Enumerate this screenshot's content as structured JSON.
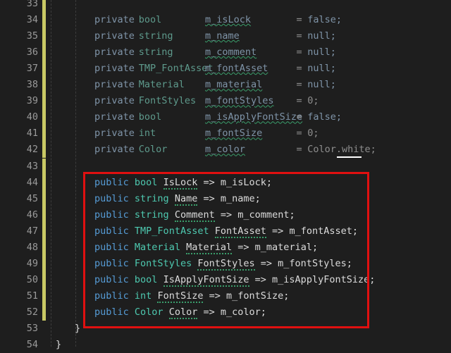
{
  "editor": {
    "lines": [
      {
        "n": "33",
        "margin": "#c8c864",
        "kind": "blank"
      },
      {
        "n": "34",
        "margin": "#c8c864",
        "kind": "field",
        "mod": "private",
        "type": "bool",
        "name": "m_isLock",
        "val": "false;",
        "valkw": true
      },
      {
        "n": "35",
        "margin": "#c8c864",
        "kind": "field",
        "mod": "private",
        "type": "string",
        "name": "m_name",
        "val": "null;",
        "valkw": true
      },
      {
        "n": "36",
        "margin": "#c8c864",
        "kind": "field",
        "mod": "private",
        "type": "string",
        "name": "m_comment",
        "val": "null;",
        "valkw": true
      },
      {
        "n": "37",
        "margin": "#c8c864",
        "kind": "field",
        "mod": "private",
        "type": "TMP_FontAsset",
        "name": "m_fontAsset",
        "val": "null;",
        "valkw": true
      },
      {
        "n": "38",
        "margin": "#c8c864",
        "kind": "field",
        "mod": "private",
        "type": "Material",
        "name": "m_material",
        "val": "null;",
        "valkw": true
      },
      {
        "n": "39",
        "margin": "#c8c864",
        "kind": "field",
        "mod": "private",
        "type": "FontStyles",
        "name": "m_fontStyles",
        "val": "0;",
        "valkw": false
      },
      {
        "n": "40",
        "margin": "#c8c864",
        "kind": "field",
        "mod": "private",
        "type": "bool",
        "name": "m_isApplyFontSize",
        "val": "false;",
        "valkw": true
      },
      {
        "n": "41",
        "margin": "#c8c864",
        "kind": "field",
        "mod": "private",
        "type": "int",
        "name": "m_fontSize",
        "val": "0;",
        "valkw": false
      },
      {
        "n": "42",
        "margin": "#c8c864",
        "kind": "field",
        "mod": "private",
        "type": "Color",
        "name": "m_color",
        "val": "Color.white;",
        "valkw": false
      },
      {
        "n": "43",
        "margin": "#c8c864",
        "kind": "blank"
      },
      {
        "n": "44",
        "margin": "#c8c864",
        "kind": "prop",
        "mod": "public",
        "type": "bool",
        "name": "IsLock",
        "arrow": "=>",
        "target": "m_isLock;"
      },
      {
        "n": "45",
        "margin": "#c8c864",
        "kind": "prop",
        "mod": "public",
        "type": "string",
        "name": "Name",
        "arrow": "=>",
        "target": "m_name;"
      },
      {
        "n": "46",
        "margin": "#c8c864",
        "kind": "prop",
        "mod": "public",
        "type": "string",
        "name": "Comment",
        "arrow": "=>",
        "target": "m_comment;"
      },
      {
        "n": "47",
        "margin": "#c8c864",
        "kind": "prop",
        "mod": "public",
        "type": "TMP_FontAsset",
        "name": "FontAsset",
        "arrow": "=>",
        "target": "m_fontAsset;"
      },
      {
        "n": "48",
        "margin": "#c8c864",
        "kind": "prop",
        "mod": "public",
        "type": "Material",
        "name": "Material",
        "arrow": "=>",
        "target": "m_material;"
      },
      {
        "n": "49",
        "margin": "#c8c864",
        "kind": "prop",
        "mod": "public",
        "type": "FontStyles",
        "name": "FontStyles",
        "arrow": "=>",
        "target": "m_fontStyles;"
      },
      {
        "n": "50",
        "margin": "#c8c864",
        "kind": "prop",
        "mod": "public",
        "type": "bool",
        "name": "IsApplyFontSize",
        "arrow": "=>",
        "target": "m_isApplyFontSize;"
      },
      {
        "n": "51",
        "margin": "#c8c864",
        "kind": "prop",
        "mod": "public",
        "type": "int",
        "name": "FontSize",
        "arrow": "=>",
        "target": "m_fontSize;"
      },
      {
        "n": "52",
        "margin": "#c8c864",
        "kind": "prop",
        "mod": "public",
        "type": "Color",
        "name": "Color",
        "arrow": "=>",
        "target": "m_color;"
      },
      {
        "n": "53",
        "margin": "",
        "kind": "brace",
        "text": "}"
      },
      {
        "n": "54",
        "margin": "",
        "kind": "brace2",
        "text": "}"
      }
    ],
    "colors": {
      "background": "#1e1e1e",
      "keyword": "#569cd6",
      "type": "#4ec9b0",
      "text": "#dcdcdc",
      "line_number": "#9a9a9a",
      "change_margin": "#c8c864",
      "highlight_box": "#e01010"
    }
  }
}
